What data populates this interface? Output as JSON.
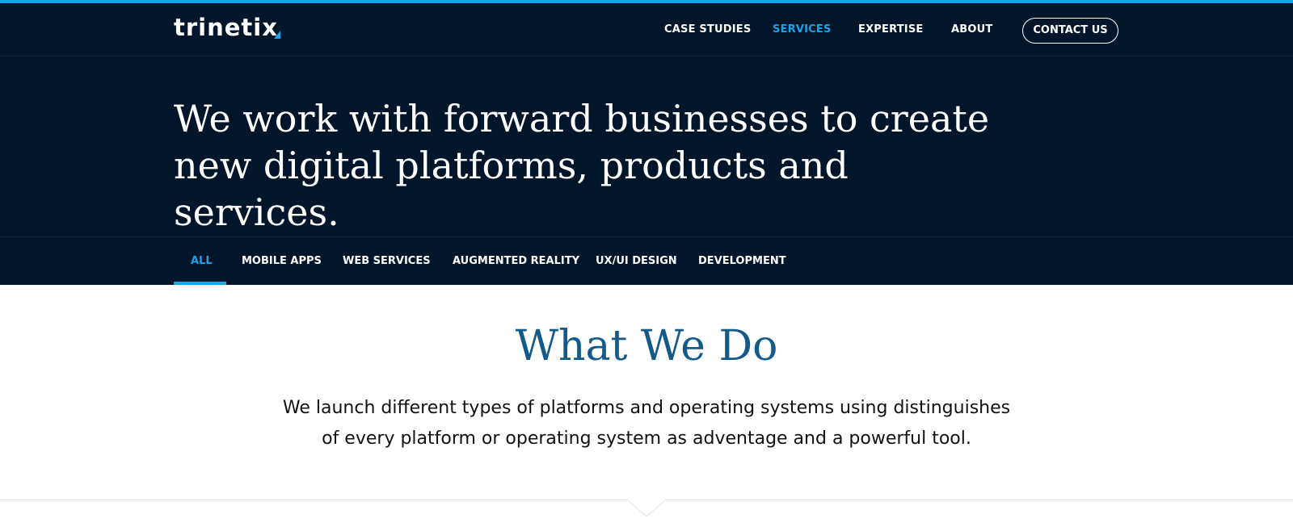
{
  "brand": {
    "logo_text": "trinetix",
    "accent_color": "#1aa3e8",
    "dark_bg": "#02162b",
    "title_color": "#135a8a"
  },
  "nav": {
    "items": [
      {
        "label": "CASE STUDIES",
        "active": false
      },
      {
        "label": "SERVICES",
        "active": true
      },
      {
        "label": "EXPERTISE",
        "active": false
      },
      {
        "label": "ABOUT",
        "active": false
      }
    ],
    "contact_label": "CONTACT US"
  },
  "hero": {
    "title": "We work with forward businesses to create new digital platforms, products and services."
  },
  "filters": {
    "items": [
      {
        "label": "ALL",
        "active": true
      },
      {
        "label": "MOBILE APPS",
        "active": false
      },
      {
        "label": "WEB SERVICES",
        "active": false
      },
      {
        "label": "AUGMENTED REALITY",
        "active": false
      },
      {
        "label": "UX/UI DESIGN",
        "active": false
      },
      {
        "label": "DEVELOPMENT",
        "active": false
      }
    ]
  },
  "section": {
    "title": "What We Do",
    "description": "We launch different types of platforms and operating systems using distinguishes of every platform or operating system as adventage and a powerful tool."
  },
  "icons": {
    "divider_notch": "chevron-down-icon"
  }
}
